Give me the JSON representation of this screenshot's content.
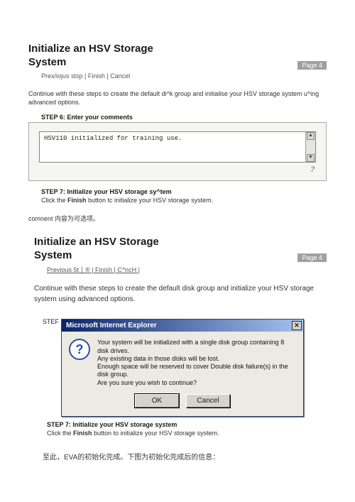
{
  "section1": {
    "title": "Initialize an HSV Storage System",
    "page_badge": "Page 4",
    "nav": "Prex/iojus stsp | Finish | Cancel",
    "intro": "Continue with these steps to create the default di^k group and initialise your HSV storage system u^ing advanced options.",
    "step6_label": "STEP 6: Enter your comments",
    "textarea_value": "HSV110 initialized for training use.",
    "help": "?",
    "step7_label": "STEP 7: Initialize your HSV storage sy^tem",
    "step7_desc_a": "Click the ",
    "step7_desc_b": "Finish",
    "step7_desc_c": " button tc initialize your HSV storage system.",
    "note": "comnent 内容为可选项。"
  },
  "section2": {
    "title": "Initialize an HSV Storage System",
    "page_badge": "Page 4",
    "nav": "Previous 5t丨® | Finish | C^ncH |",
    "intro": "Continue with these steps to create the default disk group and initialize your HSV storage system using advanced options.",
    "stef": "STEF",
    "dialog": {
      "title": "Microsoft Internet Explorer",
      "msg_l1": "Your system will be initialized with a single disk group containing 8 disk drives.",
      "msg_l2": "Any existing data in those disks will be lost.",
      "msg_l3": "Enough space will be reserved to cover Double disk failure(s) in the disk group.",
      "msg_l4": "Are you sure you wish to continue?",
      "ok": "OK",
      "cancel": "Cancel",
      "icon": "?"
    },
    "step7_label": "STEP 7: Initialize your HSV storage system",
    "step7_desc_a": "Click the ",
    "step7_desc_b": "Finish",
    "step7_desc_c": " button to initialize your HSV storage system.",
    "final": "至此，EVA的初始化完成。下图为初始化完成后的信息："
  }
}
